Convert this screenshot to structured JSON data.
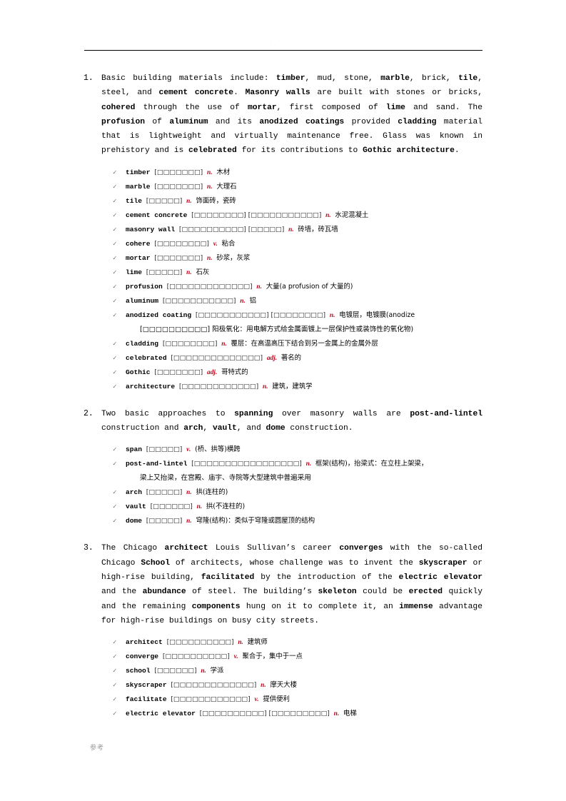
{
  "page": {
    "header_text": ". . . .",
    "footer_text": "参考",
    "check_glyph": "✓"
  },
  "sections": [
    {
      "number": "1.",
      "paragraph_html": "Basic building materials include: <b>timber</b>, mud, stone, <b>marble</b>, brick, <b>tile</b>, steel, and <b>cement concrete</b>. <b>Masonry walls</b> are built with stones or bricks, <b>cohered</b> through the use of <b>mortar</b>, first composed of <b>lime</b> and sand. The <b>profusion</b> of <b>aluminum</b> and its <b>anodized coatings</b> provided <b>cladding</b> material that is lightweight and virtually maintenance free. Glass was known in prehistory and is <b>celebrated</b> for its contributions to <b>Gothic architecture</b>.",
      "paragraph_text": "Basic building materials include: timber, mud, stone, marble, brick, tile, steel, and cement concrete. Masonry walls are built with stones or bricks, cohered through the use of mortar, first composed of lime and sand. The profusion of aluminum and its anodized coatings provided cladding material that is lightweight and virtually maintenance free. Glass was known in prehistory and is celebrated for its contributions to Gothic architecture.",
      "vocab": [
        {
          "word": "timber",
          "ipa": "[□□□□□□□]",
          "pos": "n.",
          "meaning": "木材"
        },
        {
          "word": "marble",
          "ipa": "[□□□□□□□]",
          "pos": "n.",
          "meaning": "大理石"
        },
        {
          "word": "tile",
          "ipa": "[□□□□□]",
          "pos": "n.",
          "meaning": "饰面砖，瓷砖"
        },
        {
          "word": "cement concrete",
          "ipa": "[□□□□□□□□] [□□□□□□□□□□□]",
          "pos": "n.",
          "meaning": "水泥混凝土"
        },
        {
          "word": "masonry wall",
          "ipa": "[□□□□□□□□□□] [□□□□□]",
          "pos": "n.",
          "meaning": "砖墙，砖瓦墙"
        },
        {
          "word": "cohere",
          "ipa": "[□□□□□□□□]",
          "pos": "v.",
          "meaning": "粘合"
        },
        {
          "word": "mortar",
          "ipa": "[□□□□□□□]",
          "pos": "n.",
          "meaning": "砂浆，灰浆"
        },
        {
          "word": "lime",
          "ipa": "[□□□□□]",
          "pos": "n.",
          "meaning": "石灰"
        },
        {
          "word": "profusion",
          "ipa": "[□□□□□□□□□□□□□]",
          "pos": "n.",
          "meaning": "大量(a profusion of 大量的)"
        },
        {
          "word": "aluminum",
          "ipa": "[□□□□□□□□□□□]",
          "pos": "n.",
          "meaning": "铝"
        },
        {
          "word": "anodized coating",
          "ipa": "[□□□□□□□□□□□] [□□□□□□□□]",
          "pos": "n.",
          "meaning": "电镀层，电镀膜(anodize",
          "cont": "[□□□□□□□□□□] 阳极氧化：用电解方式给金属面镀上一层保护性或装饰性的氧化物)"
        },
        {
          "word": "cladding",
          "ipa": "[□□□□□□□□]",
          "pos": "n.",
          "meaning": "覆层：在高温高压下结合到另一金属上的金属外层"
        },
        {
          "word": "celebrated",
          "ipa": "[□□□□□□□□□□□□□□]",
          "pos": "adj.",
          "meaning": "著名的"
        },
        {
          "word": "Gothic",
          "ipa": "[□□□□□□□]",
          "pos": "adj.",
          "meaning": "哥特式的"
        },
        {
          "word": "architecture",
          "ipa": "[□□□□□□□□□□□□]",
          "pos": "n.",
          "meaning": "建筑，建筑学"
        }
      ]
    },
    {
      "number": "2.",
      "paragraph_html": "Two basic approaches to <b>spanning</b> over masonry walls are <b>post-and-lintel</b> construction and <b>arch</b>, <b>vault</b>, and <b>dome</b> construction.",
      "paragraph_text": "Two basic approaches to spanning over masonry walls are post-and-lintel construction and arch, vault, and dome construction.",
      "vocab": [
        {
          "word": "span",
          "ipa": "[□□□□□]",
          "pos": "v.",
          "meaning": "(桥、拱等)横跨"
        },
        {
          "word": "post-and-lintel",
          "ipa": "[□□□□□□□□□□□□□□□□□]",
          "pos": "n.",
          "meaning": "框架(结构)，抬梁式：在立柱上架梁，",
          "cont": "梁上又抬梁，在宫殿、庙宇、寺院等大型建筑中普遍采用"
        },
        {
          "word": "arch",
          "ipa": "[□□□□□]",
          "pos": "n.",
          "meaning": "拱(连柱的)"
        },
        {
          "word": "vault",
          "ipa": "[□□□□□□]",
          "pos": "n.",
          "meaning": "拱(不连柱的)"
        },
        {
          "word": "dome",
          "ipa": "[□□□□□]",
          "pos": "n.",
          "meaning": "穹隆(结构)：类似于穹隆或圆屋顶的结构"
        }
      ]
    },
    {
      "number": "3.",
      "paragraph_html": "The Chicago <b>architect</b> Louis Sullivan’s career <b>converges</b> with the so-called Chicago <b>School</b> of architects, whose challenge was to invent the <b>skyscraper</b> or high-rise building, <b>facilitated</b> by the introduction of the <b>electric elevator</b> and the <b>abundance</b> of steel. The building’s <b>skeleton</b> could be <b>erected</b> quickly and the remaining <b>components</b> hung on it to complete it, an <b>immense</b> advantage for high-rise buildings on busy city streets.",
      "paragraph_text": "The Chicago architect Louis Sullivan’s career converges with the so-called Chicago School of architects, whose challenge was to invent the skyscraper or high-rise building, facilitated by the introduction of the electric elevator and the abundance of steel. The building’s skeleton could be erected quickly and the remaining components hung on it to complete it, an immense advantage for high-rise buildings on busy city streets.",
      "vocab": [
        {
          "word": "architect",
          "ipa": "[□□□□□□□□□□]",
          "pos": "n.",
          "meaning": "建筑师"
        },
        {
          "word": "converge",
          "ipa": "[□□□□□□□□□□]",
          "pos": "v.",
          "meaning": "聚合于，集中于一点"
        },
        {
          "word": "school",
          "ipa": "[□□□□□□]",
          "pos": "n.",
          "meaning": "学派"
        },
        {
          "word": "skyscraper",
          "ipa": "[□□□□□□□□□□□□□]",
          "pos": "n.",
          "meaning": "摩天大楼"
        },
        {
          "word": "facilitate",
          "ipa": "[□□□□□□□□□□□□]",
          "pos": "v.",
          "meaning": "提供便利"
        },
        {
          "word": "electric elevator",
          "ipa": "[□□□□□□□□□□] [□□□□□□□□□]",
          "pos": "n.",
          "meaning": "电梯"
        }
      ]
    }
  ]
}
